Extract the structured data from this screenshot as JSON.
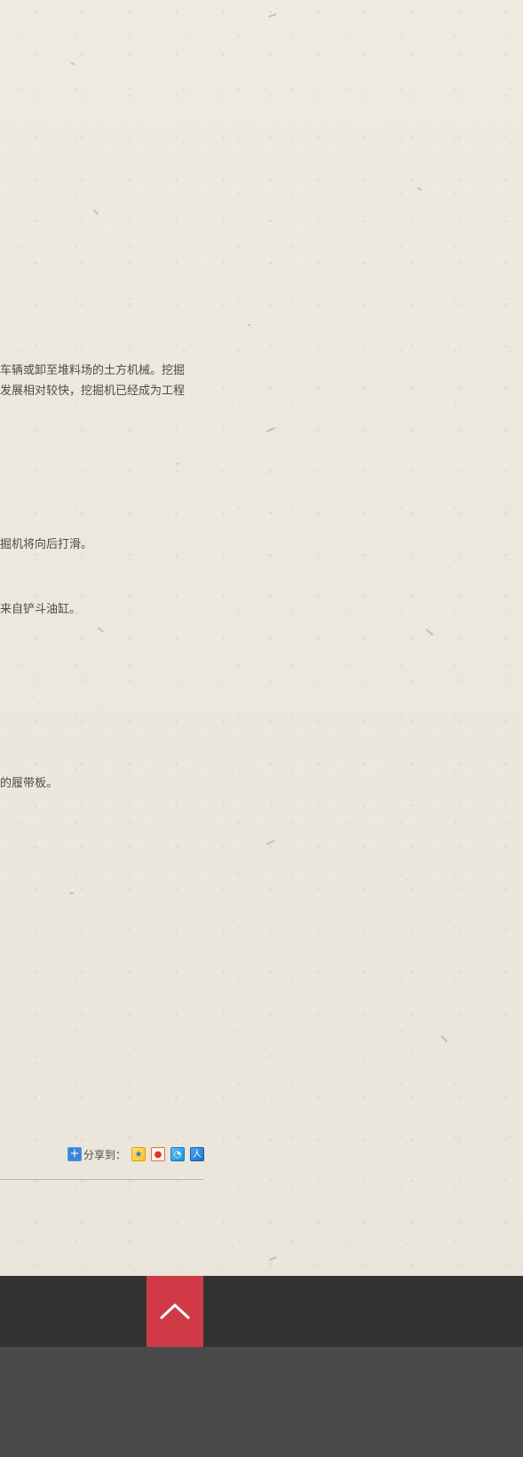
{
  "article": {
    "line1": "车辆或卸至堆料场的土方机械。挖掘",
    "line2": "发展相对较快，挖掘机已经成为工程",
    "line3": "掘机将向后打滑。",
    "line4": "来自铲斗油缸。",
    "line5": "的履带板。"
  },
  "share": {
    "label": "分享到："
  },
  "colors": {
    "paper": "#ece8dd",
    "footer_top": "#323232",
    "footer_bottom": "#4a4a4a",
    "back_to_top": "#d03a46",
    "share_plus": "#3b86d8"
  },
  "icons": {
    "share_plus": "plus-square-icon",
    "qzone": "qzone-icon",
    "weibo": "weibo-icon",
    "tencent": "tencent-weibo-icon",
    "renren": "renren-icon",
    "back_to_top": "chevron-up-icon"
  }
}
